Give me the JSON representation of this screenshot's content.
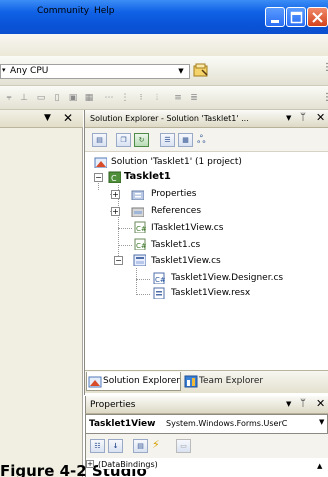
{
  "window": {
    "accent": "#0a54d8",
    "buttons": [
      "minimize-icon",
      "maximize-icon",
      "close-icon"
    ]
  },
  "menu": {
    "items": [
      "Community",
      "Help"
    ]
  },
  "toolbar": {
    "configuration": "Any CPU"
  },
  "solution_explorer": {
    "title": "Solution Explorer - Solution 'Tasklet1' ...",
    "tree": {
      "solution": "Solution 'Tasklet1' (1 project)",
      "project": "Tasklet1",
      "properties": "Properties",
      "references": "References",
      "file1": "ITasklet1View.cs",
      "file2": "Tasklet1.cs",
      "file3": "Tasklet1View.cs",
      "file3_child1": "Tasklet1View.Designer.cs",
      "file3_child2": "Tasklet1View.resx"
    },
    "tabs": {
      "solution_explorer": "Solution Explorer",
      "team_explorer": "Team Explorer"
    }
  },
  "properties": {
    "title": "Properties",
    "object_name": "Tasklet1View",
    "object_type": "System.Windows.Forms.UserC",
    "first_row": "(DataBindings)"
  },
  "caption": {
    "text": "Figure 4-2 Studio"
  }
}
